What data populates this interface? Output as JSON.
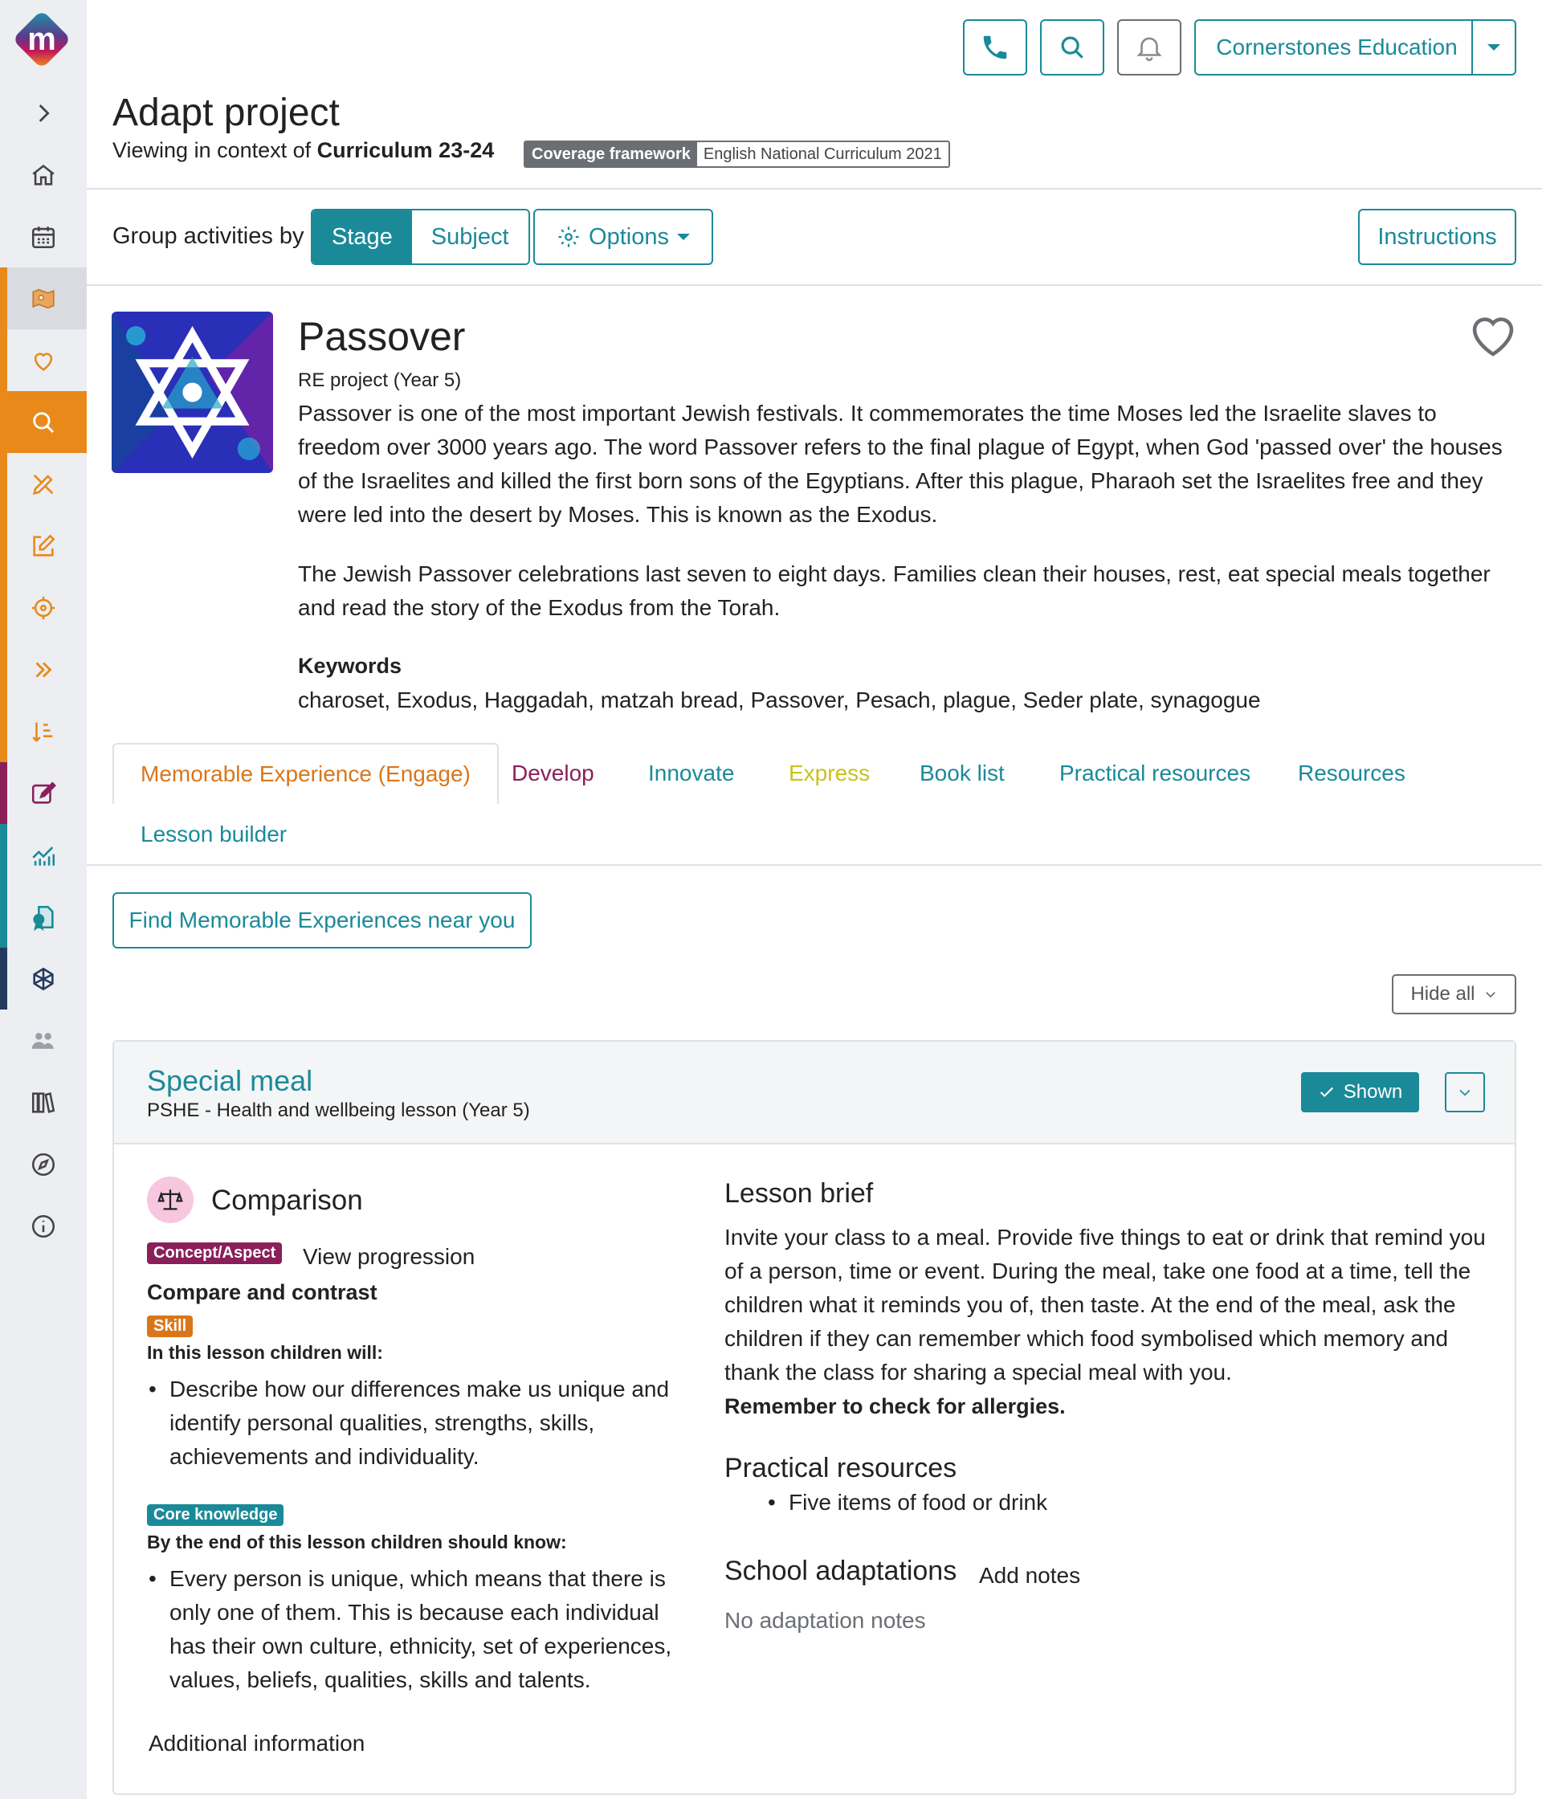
{
  "app": {
    "logo_letter": "m"
  },
  "sidebar": {
    "items": [
      {
        "name": "expand",
        "icon": "chevron-right-icon"
      },
      {
        "name": "home",
        "icon": "home-icon"
      },
      {
        "name": "calendar",
        "icon": "calendar-icon"
      },
      {
        "name": "projects",
        "icon": "map-icon",
        "bar": "#e8891a"
      },
      {
        "name": "favourites",
        "icon": "heart-icon",
        "bar": "#e8891a"
      },
      {
        "name": "search",
        "icon": "search-icon",
        "bar": "#e8891a"
      },
      {
        "name": "design",
        "icon": "pencil-ruler-icon",
        "bar": "#e8891a"
      },
      {
        "name": "edit",
        "icon": "edit-icon",
        "bar": "#e8891a"
      },
      {
        "name": "target",
        "icon": "crosshair-icon",
        "bar": "#e8891a"
      },
      {
        "name": "forward",
        "icon": "double-chevron-icon",
        "bar": "#e8891a"
      },
      {
        "name": "sort",
        "icon": "sort-icon",
        "bar": "#e8891a"
      },
      {
        "name": "assess",
        "icon": "pencil-square-icon",
        "bar": "#8a1f5a"
      },
      {
        "name": "analytics",
        "icon": "chart-icon",
        "bar": "#1a8a99"
      },
      {
        "name": "certificate",
        "icon": "certificate-icon",
        "bar": "#1a8a99"
      },
      {
        "name": "network",
        "icon": "network-icon",
        "bar": "#233a5e"
      },
      {
        "name": "people",
        "icon": "people-icon"
      },
      {
        "name": "library",
        "icon": "books-icon"
      },
      {
        "name": "compass",
        "icon": "compass-icon"
      },
      {
        "name": "info",
        "icon": "info-icon"
      }
    ]
  },
  "header": {
    "org_name": "Cornerstones Education",
    "page_title": "Adapt project",
    "context_prefix": "Viewing in context of ",
    "context_value": "Curriculum 23-24",
    "coverage_key": "Coverage framework",
    "coverage_value": "English National Curriculum 2021",
    "icons": [
      "phone-icon",
      "search-icon",
      "bell-icon"
    ]
  },
  "toolbar": {
    "group_label": "Group activities by",
    "group_options": [
      "Stage",
      "Subject"
    ],
    "options_label": "Options",
    "instructions_label": "Instructions"
  },
  "project": {
    "title": "Passover",
    "type": "RE project (Year 5)",
    "description_1": "Passover is one of the most important Jewish festivals. It commemorates the time Moses led the Israelite slaves to freedom over 3000 years ago. The word Passover refers to the final plague of Egypt, when God 'passed over' the houses of the Israelites and killed the first born sons of the Egyptians. After this plague, Pharaoh set the Israelites free and they were led into the desert by Moses. This is known as the Exodus.",
    "description_2": "The Jewish Passover celebrations last seven to eight days. Families clean their houses, rest, eat special meals together and read the story of the Exodus from the Torah.",
    "keywords_heading": "Keywords",
    "keywords": "charoset, Exodus, Haggadah, matzah bread, Passover, Pesach, plague, Seder plate, synagogue"
  },
  "tabs": [
    {
      "label": "Memorable Experience (Engage)",
      "color": "#d9761a"
    },
    {
      "label": "Develop",
      "color": "#8a1f5a"
    },
    {
      "label": "Innovate",
      "color": "#1a8a99"
    },
    {
      "label": "Express",
      "color": "#c9c21a"
    },
    {
      "label": "Book list",
      "color": "#1a8a99"
    },
    {
      "label": "Practical resources",
      "color": "#1a8a99"
    },
    {
      "label": "Resources",
      "color": "#1a8a99"
    },
    {
      "label": "Lesson builder",
      "color": "#1a8a99"
    }
  ],
  "actions": {
    "find_label": "Find Memorable Experiences near you",
    "hide_all_label": "Hide all"
  },
  "activity": {
    "title": "Special meal",
    "subtitle": "PSHE - Health and wellbeing lesson (Year 5)",
    "shown_label": "Shown",
    "concept_title": "Comparison",
    "concept_badge": "Concept/Aspect",
    "view_progression": "View progression",
    "skill_title": "Compare and contrast",
    "skill_badge": "Skill",
    "will_heading": "In this lesson children will:",
    "will_item": "Describe how our differences make us unique and identify personal qualities, strengths, skills, achievements and individuality.",
    "core_badge": "Core knowledge",
    "know_heading": "By the end of this lesson children should know:",
    "know_item": "Every person is unique, which means that there is only one of them. This is because each individual has their own culture, ethnicity, set of experiences, values, beliefs, qualities, skills and talents.",
    "additional_info": "Additional information",
    "brief_heading": "Lesson brief",
    "brief_text": "Invite your class to a meal. Provide five things to eat or drink that remind you of a person, time or event. During the meal, take one food at a time, tell the children what it reminds you of, then taste. At the end of the meal, ask the children if they can remember which food symbolised which memory and thank the class for sharing a special meal with you.",
    "brief_warning": "Remember to check for allergies.",
    "resources_heading": "Practical resources",
    "resources_item": "Five items of food or drink",
    "adaptations_heading": "School adaptations",
    "add_notes": "Add notes",
    "no_notes": "No adaptation notes"
  },
  "colors": {
    "teal": "#1a8a99",
    "orange": "#e8891a",
    "plum": "#8a1f5a",
    "skill": "#d9761a"
  }
}
